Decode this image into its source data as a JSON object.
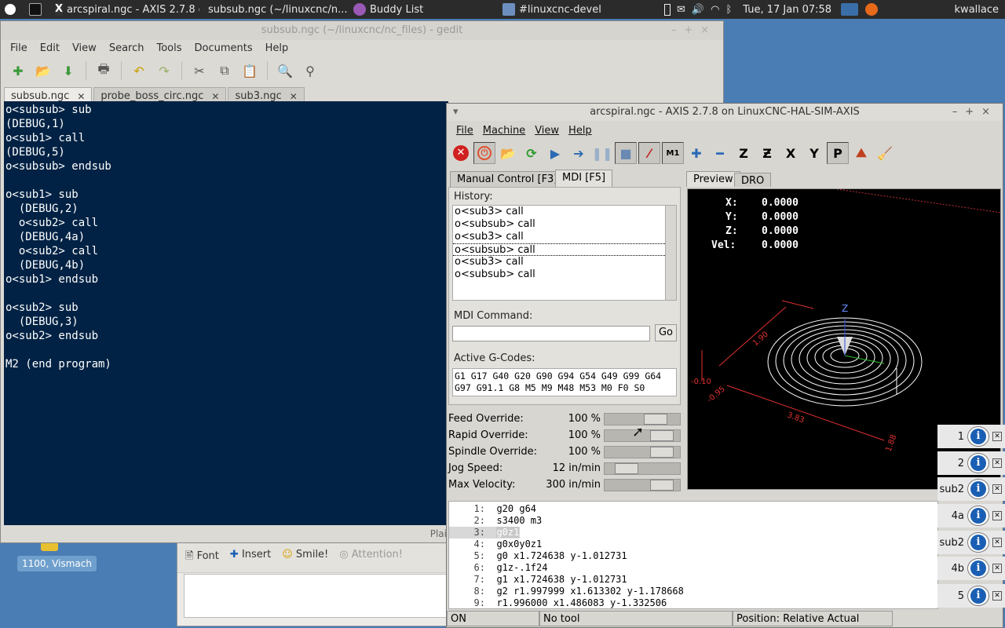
{
  "panel": {
    "tasks": [
      "arcspiral.ngc - AXIS 2.7.8 o...",
      "subsub.ngc (~/linuxcnc/n...",
      "Buddy List",
      "#linuxcnc-devel"
    ],
    "clock": "Tue, 17 Jan  07:58",
    "user": "kwallace"
  },
  "desktop": {
    "icon_label": "1100, Vismach"
  },
  "gedit": {
    "title": "subsub.ngc (~/linuxcnc/nc_files) - gedit",
    "menu": [
      "File",
      "Edit",
      "View",
      "Search",
      "Tools",
      "Documents",
      "Help"
    ],
    "tabs": [
      "subsub.ngc",
      "probe_boss_circ.ngc",
      "sub3.ngc"
    ],
    "code": "o<subsub> sub\n(DEBUG,1)\no<sub1> call\n(DEBUG,5)\no<subsub> endsub\n\no<sub1> sub\n  (DEBUG,2)\n  o<sub2> call\n  (DEBUG,4a)\n  o<sub2> call\n  (DEBUG,4b)\no<sub1> endsub\n\no<sub2> sub\n  (DEBUG,3)\no<sub2> endsub\n\nM2 (end program)",
    "status": "Plai"
  },
  "chat": {
    "buttons": [
      "Font",
      "Insert",
      "Smile!",
      "Attention!"
    ]
  },
  "axis": {
    "title": "arcspiral.ngc - AXIS 2.7.8 on LinuxCNC-HAL-SIM-AXIS",
    "menu": [
      "File",
      "Machine",
      "View",
      "Help"
    ],
    "tabs": [
      "Manual Control [F3]",
      "MDI [F5]"
    ],
    "right_tabs": [
      "Preview",
      "DRO"
    ],
    "history_label": "History:",
    "history": [
      "o<sub3> call",
      "o<subsub> call",
      "o<sub3> call",
      "o<subsub> call",
      "o<sub3> call",
      "o<subsub> call"
    ],
    "mdi_label": "MDI Command:",
    "go": "Go",
    "gcodes_label": "Active G-Codes:",
    "gcodes": "G1 G17 G40 G20 G90 G94 G54 G49 G99 G64\nG97 G91.1 G8 M5 M9 M48 M53 M0 F0 S0",
    "overrides": [
      {
        "name": "Feed Override:",
        "value": "100 %",
        "level": 0.75
      },
      {
        "name": "Rapid Override:",
        "value": "100 %",
        "level": 0.88
      },
      {
        "name": "Spindle Override:",
        "value": "100 %",
        "level": 0.88
      },
      {
        "name": "Jog Speed:",
        "value": "12 in/min",
        "level": 0.2
      },
      {
        "name": "Max Velocity:",
        "value": "300 in/min",
        "level": 0.88
      }
    ],
    "dro": [
      {
        "axis": "X:",
        "value": "0.0000"
      },
      {
        "axis": "Y:",
        "value": "0.0000"
      },
      {
        "axis": "Z:",
        "value": "0.0000"
      },
      {
        "axis": "Vel:",
        "value": "0.0000"
      }
    ],
    "preview_labels": [
      "Z",
      "3.83",
      "1.88",
      "-0.95",
      "-0.10",
      "1.90"
    ],
    "program": [
      {
        "n": "1:",
        "t": "g20 g64"
      },
      {
        "n": "2:",
        "t": "s3400 m3"
      },
      {
        "n": "3:",
        "t": "g0z1"
      },
      {
        "n": "4:",
        "t": "g0x0y0z1"
      },
      {
        "n": "5:",
        "t": "g0 x1.724638 y-1.012731"
      },
      {
        "n": "6:",
        "t": "g1z-.1f24"
      },
      {
        "n": "7:",
        "t": "g1 x1.724638 y-1.012731"
      },
      {
        "n": "8:",
        "t": "g2 r1.997999 x1.613302 y-1.178668"
      },
      {
        "n": "9:",
        "t": "r1.996000 x1.486083 y-1.332506"
      }
    ],
    "status": [
      "ON",
      "No tool",
      "Position: Relative Actual"
    ]
  },
  "notifications": [
    "1",
    "2",
    "sub2",
    "4a",
    "sub2",
    "4b",
    "5"
  ]
}
